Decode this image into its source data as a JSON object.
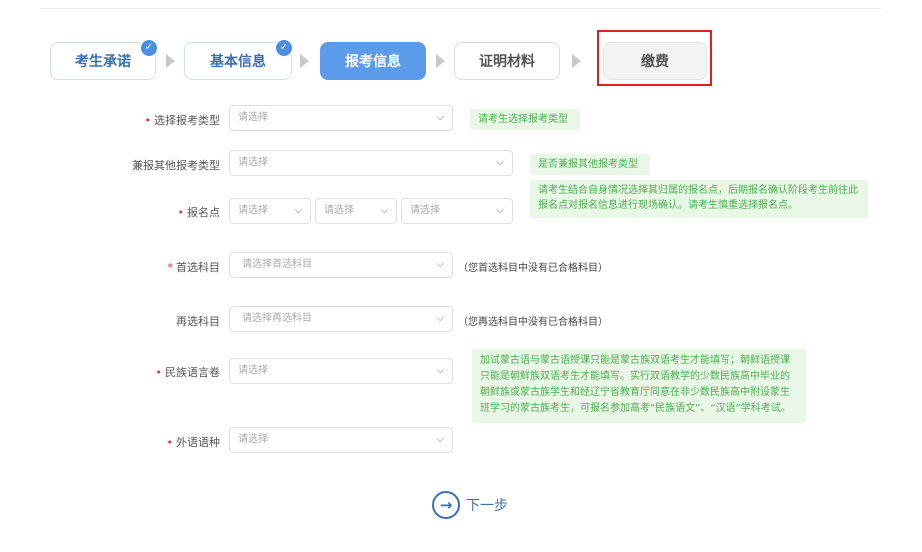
{
  "steps": [
    {
      "label": "考生承诺",
      "state": "done",
      "icon": "check-icon"
    },
    {
      "label": "基本信息",
      "state": "done",
      "icon": "check-icon"
    },
    {
      "label": "报考信息",
      "state": "active"
    },
    {
      "label": "证明材料",
      "state": "todo"
    },
    {
      "label": "缴费",
      "state": "todo"
    }
  ],
  "form": {
    "exam_type": {
      "label": "选择报考类型",
      "placeholder": "请选择",
      "hint": "请考生选择报考类型"
    },
    "other_exam_type": {
      "label": "兼报其他报考类型",
      "placeholder": "请选择",
      "hint": "是否兼报其他报考类型"
    },
    "exam_site": {
      "label": "报名点",
      "placeholders": [
        "请选择",
        "请选择",
        "请选择"
      ],
      "hint": "请考生结合自身情况选择其归属的报名点，后期报名确认阶段考生前往此报名点对报名信息进行现场确认。请考生慎重选择报名点。"
    },
    "first_subject": {
      "label": "首选科目",
      "placeholder": "请选择首选科目",
      "note": "（您首选科目中没有已合格科目）"
    },
    "second_subject": {
      "label": "再选科目",
      "placeholder": "请选择再选科目",
      "note": "（您再选科目中没有已合格科目）"
    },
    "ethnic_language": {
      "label": "民族语言卷",
      "placeholder": "请选择",
      "hint": "加试蒙古语与蒙古语授课只能是蒙古族双语考生才能填写；朝鲜语授课只能是朝鲜族双语考生才能填写。实行双语教学的少数民族高中毕业的朝鲜族或蒙古族学生和经辽宁省教育厅同意在非少数民族高中附设蒙生班学习的蒙古族考生，可报名参加高考“民族语文”、“汉语”学科考试。"
    },
    "foreign_language": {
      "label": "外语语种",
      "placeholder": "请选择"
    }
  },
  "next_button": {
    "label": "下一步",
    "icon": "arrow-right-circle-icon"
  },
  "colors": {
    "accent": "#5b9bea",
    "required": "#e53935",
    "hint_bg": "#e9f7e7",
    "hint_text": "#4caf50",
    "highlight_box": "#e02020"
  }
}
